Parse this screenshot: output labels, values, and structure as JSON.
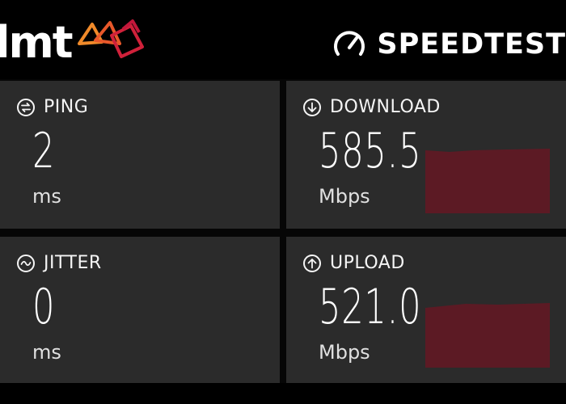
{
  "header": {
    "brand": "lmt",
    "app_name": "SPEEDTEST"
  },
  "colors": {
    "background": "#060606",
    "card": "#2b2b2b",
    "graph_fill": "#5c1a24",
    "brand_orange": "#f08a2a",
    "brand_red": "#d0213a"
  },
  "icons": {
    "ping": "ping-arrows-icon",
    "jitter": "jitter-wave-icon",
    "download": "download-arrow-icon",
    "upload": "upload-arrow-icon",
    "speedtest": "speedometer-icon"
  },
  "metrics": {
    "ping": {
      "label": "PING",
      "value": "2",
      "unit": "ms"
    },
    "jitter": {
      "label": "JITTER",
      "value": "0",
      "unit": "ms"
    },
    "download": {
      "label": "DOWNLOAD",
      "value": "585.5",
      "unit": "Mbps"
    },
    "upload": {
      "label": "UPLOAD",
      "value": "521.0",
      "unit": "Mbps"
    }
  }
}
